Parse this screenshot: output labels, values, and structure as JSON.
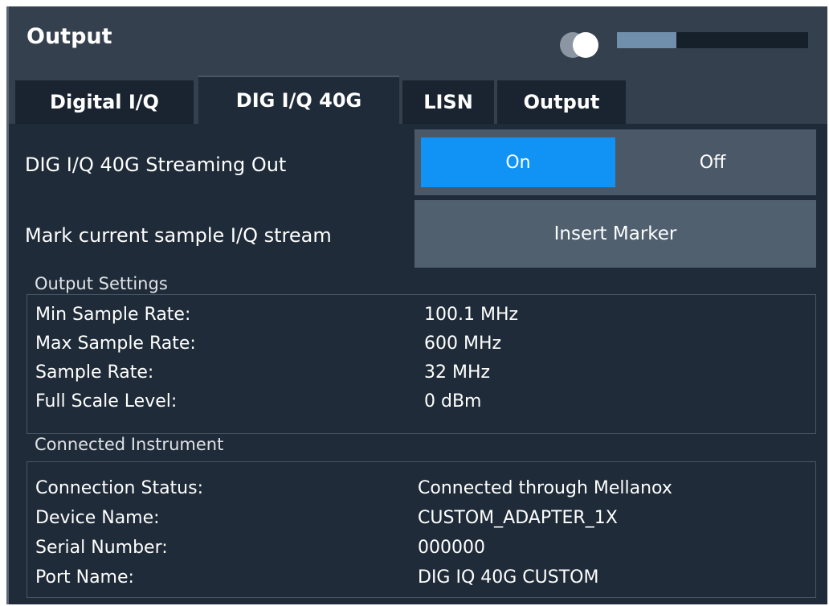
{
  "window": {
    "title": "Output",
    "progress_fraction": 0.31
  },
  "tabs": [
    {
      "label": "Digital I/Q"
    },
    {
      "label": "DIG I/Q 40G"
    },
    {
      "label": "LISN"
    },
    {
      "label": "Output"
    }
  ],
  "streaming": {
    "label": "DIG I/Q 40G Streaming Out",
    "on_label": "On",
    "off_label": "Off",
    "selected": "On"
  },
  "marker": {
    "label": "Mark current sample I/Q stream",
    "button_label": "Insert Marker"
  },
  "output_settings": {
    "title": "Output Settings",
    "rows": [
      {
        "label": "Min Sample Rate:",
        "value": "100.1 MHz"
      },
      {
        "label": "Max Sample Rate:",
        "value": "600 MHz"
      },
      {
        "label": "Sample Rate:",
        "value": "32 MHz"
      },
      {
        "label": "Full Scale Level:",
        "value": "0 dBm"
      }
    ]
  },
  "connected_instrument": {
    "title": "Connected Instrument",
    "rows": [
      {
        "label": "Connection Status:",
        "value": "Connected through Mellanox"
      },
      {
        "label": "Device Name:",
        "value": "CUSTOM_ADAPTER_1X"
      },
      {
        "label": "Serial Number:",
        "value": "000000"
      },
      {
        "label": "Port Name:",
        "value": "DIG IQ 40G CUSTOM"
      }
    ]
  },
  "colors": {
    "accent_on": "#1193f5",
    "background": "#1f2b38",
    "header": "#34404d"
  }
}
